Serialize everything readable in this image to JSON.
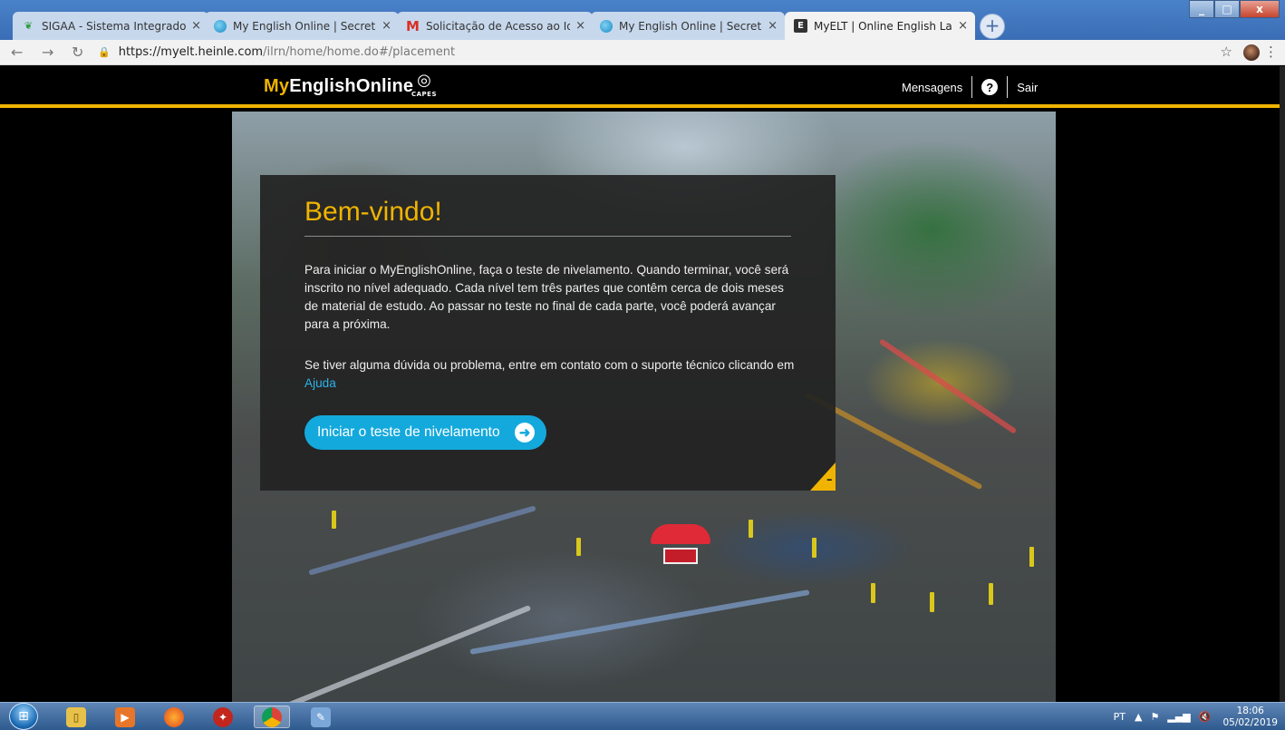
{
  "browser": {
    "tabs": [
      {
        "title": "SIGAA - Sistema Integrado de Ge",
        "icon": "sigaa-icon",
        "active": false
      },
      {
        "title": "My English Online | Secretaria Vi",
        "icon": "globe-icon",
        "active": false
      },
      {
        "title": "Solicitação de Acesso ao Idiomas",
        "icon": "gmail-icon",
        "active": false
      },
      {
        "title": "My English Online | Secretaria Vi",
        "icon": "globe-icon",
        "active": false
      },
      {
        "title": "MyELT | Online English Language",
        "icon": "elt-icon",
        "active": true
      }
    ],
    "close_glyph": "×",
    "new_tab_glyph": "+",
    "url_host": "https://myelt.heinle.com",
    "url_path": "/ilrn/home/home.do#/placement"
  },
  "site": {
    "logo_my": "My",
    "logo_rest": "EnglishOnline",
    "capes_label": "CAPES",
    "nav": {
      "messages": "Mensagens",
      "help_glyph": "?",
      "logout": "Sair"
    },
    "accent_color": "#f0b400",
    "button_color": "#14a9dc"
  },
  "welcome": {
    "title": "Bem-vindo!",
    "paragraph1": "Para iniciar o MyEnglishOnline, faça o teste de nivelamento. Quando terminar, você será inscrito no nível adequado. Cada nível tem três partes que contêm cerca de dois meses de material de estudo. Ao passar no teste no final de cada parte, você poderá avançar para a próxima.",
    "paragraph2": "Se tiver alguma dúvida ou problema, entre em contato com o suporte técnico clicando em",
    "help_link": "Ajuda",
    "start_button": "Iniciar o teste de nivelamento",
    "collapse_glyph": "–"
  },
  "taskbar": {
    "language": "PT",
    "time": "18:06",
    "date": "05/02/2019"
  }
}
